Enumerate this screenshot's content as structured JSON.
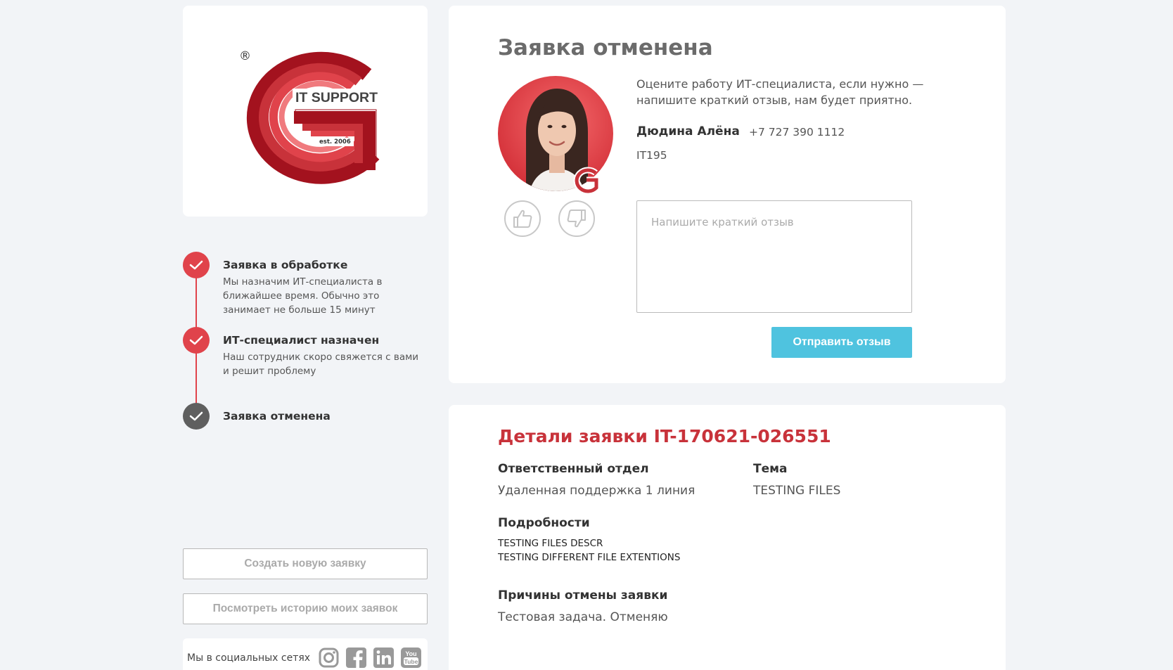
{
  "logo": {
    "text": "IT SUPPORT",
    "est": "est. 2006",
    "registered": "®"
  },
  "timeline": {
    "steps": [
      {
        "title": "Заявка в обработке",
        "desc": "Мы назначим ИТ-специалиста в ближайшее время. Обычно это занимает не больше 15 минут",
        "status": "done"
      },
      {
        "title": "ИТ-специалист назначен",
        "desc": "Наш сотрудник скоро свяжется с вами и решит проблему",
        "status": "done"
      },
      {
        "title": "Заявка отменена",
        "desc": "",
        "status": "cancelled"
      }
    ]
  },
  "actions": {
    "new_request": "Создать новую заявку",
    "history": "Посмотреть историю моих заявок"
  },
  "social": {
    "label": "Мы в социальных сетях",
    "icons": [
      "instagram-icon",
      "facebook-icon",
      "linkedin-icon",
      "youtube-icon"
    ]
  },
  "status": {
    "title": "Заявка отменена"
  },
  "specialist": {
    "prompt": "Оцените работу ИТ-специалиста, если нужно — напишите краткий отзыв, нам будет приятно.",
    "name": "Дюдина Алёна",
    "phone": "+7 727 390 1112",
    "code": "IT195"
  },
  "feedback": {
    "placeholder": "Напишите краткий отзыв",
    "value": "",
    "submit": "Отправить отзыв"
  },
  "details": {
    "title": "Детали заявки IT-170621-026551",
    "department_label": "Ответственный отдел",
    "department_value": "Удаленная поддержка 1 линия",
    "topic_label": "Тема",
    "topic_value": "TESTING FILES",
    "details_label": "Подробности",
    "details_lines": [
      "TESTING FILES DESCR",
      "TESTING DIFFERENT FILE EXTENTIONS"
    ],
    "cancel_label": "Причины отмены заявки",
    "cancel_value": "Тестовая задача. Отменяю"
  },
  "colors": {
    "accent": "#e0434b",
    "title_red": "#c8323a",
    "send_button": "#4fc3df",
    "background": "#f2f4f7"
  }
}
